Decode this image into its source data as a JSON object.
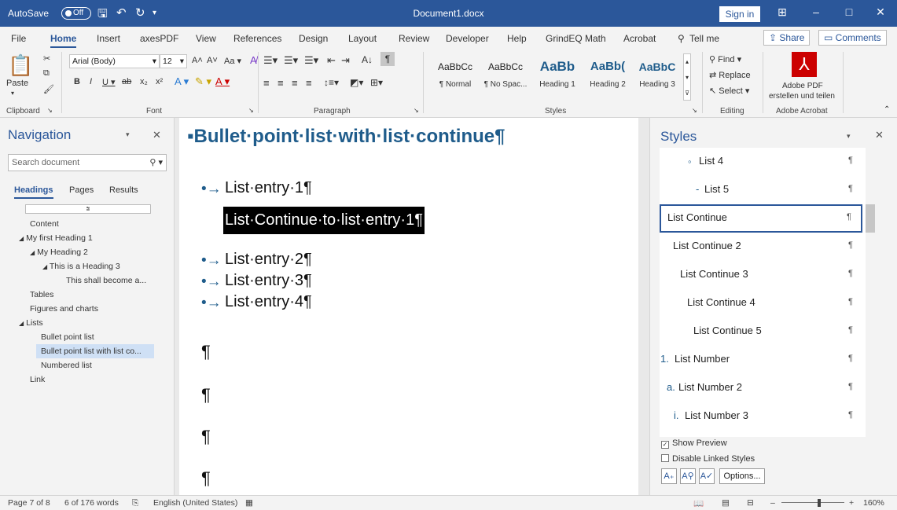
{
  "titlebar": {
    "autosave": "AutoSave",
    "autosave_state": "Off",
    "doc_title": "Document1.docx",
    "sign_in": "Sign in"
  },
  "tabs": [
    "File",
    "Home",
    "Insert",
    "axesPDF",
    "View",
    "References",
    "Design",
    "Layout",
    "Review",
    "Developer",
    "Help",
    "GrindEQ Math",
    "Acrobat",
    "Tell me"
  ],
  "active_tab": "Home",
  "share": "Share",
  "comments": "Comments",
  "ribbon": {
    "paste": "Paste",
    "font_name": "Arial (Body)",
    "font_size": "12",
    "aa": "Aa",
    "groups": {
      "clipboard": "Clipboard",
      "font": "Font",
      "paragraph": "Paragraph",
      "styles": "Styles",
      "editing": "Editing",
      "acrobat": "Adobe Acrobat"
    },
    "style_gallery": [
      {
        "preview": "AaBbCc",
        "name": "¶ Normal"
      },
      {
        "preview": "AaBbCc",
        "name": "¶ No Spac..."
      },
      {
        "preview": "AaBb",
        "name": "Heading 1"
      },
      {
        "preview": "AaBb(",
        "name": "Heading 2"
      },
      {
        "preview": "AaBbC",
        "name": "Heading 3"
      }
    ],
    "find": "Find",
    "replace": "Replace",
    "select": "Select",
    "pdf_line1": "Adobe PDF",
    "pdf_line2": "erstellen und teilen"
  },
  "navigation": {
    "title": "Navigation",
    "search_placeholder": "Search document",
    "tabs": [
      "Headings",
      "Pages",
      "Results"
    ],
    "items": [
      {
        "label": "Content"
      },
      {
        "label": "My first Heading 1",
        "arrow": "◢"
      },
      {
        "label": "My Heading 2",
        "arrow": "◢"
      },
      {
        "label": "This is a Heading 3",
        "arrow": "◢"
      },
      {
        "label": "This shall become a..."
      },
      {
        "label": "Tables"
      },
      {
        "label": "Figures and charts"
      },
      {
        "label": "Lists",
        "arrow": "◢"
      },
      {
        "label": "Bullet point list"
      },
      {
        "label": "Bullet point list with list co..."
      },
      {
        "label": "Numbered list"
      },
      {
        "label": "Link"
      }
    ]
  },
  "document": {
    "heading": "Bullet·point·list·with·list·continue¶",
    "entries": [
      "List·entry·1¶",
      "List·entry·2¶",
      "List·entry·3¶",
      "List·entry·4¶"
    ],
    "continue_text": "List·Continue·to·list·entry·1¶",
    "pilcrow": "¶"
  },
  "styles_pane": {
    "title": "Styles",
    "items": [
      {
        "prefix": "◦",
        "label": "List 4"
      },
      {
        "prefix": "-",
        "label": "List 5"
      },
      {
        "prefix": "",
        "label": "List Continue"
      },
      {
        "prefix": "",
        "label": "List Continue 2"
      },
      {
        "prefix": "",
        "label": "List Continue 3"
      },
      {
        "prefix": "",
        "label": "List Continue 4"
      },
      {
        "prefix": "",
        "label": "List Continue 5"
      },
      {
        "prefix": "1.",
        "label": "List Number"
      },
      {
        "prefix": "a.",
        "label": "List Number 2"
      },
      {
        "prefix": "i.",
        "label": "List Number 3"
      }
    ],
    "pilcrow": "¶",
    "show_preview": "Show Preview",
    "disable_linked": "Disable Linked Styles",
    "options": "Options..."
  },
  "statusbar": {
    "page": "Page 7 of 8",
    "words": "6 of 176 words",
    "language": "English (United States)",
    "zoom": "160%"
  },
  "colors": {
    "accent": "#2b579a",
    "heading_text": "#1f5c8b",
    "selection_bg": "#000000",
    "nav_selected_bg": "#cfe0f5",
    "pdf_red": "#cc0000"
  }
}
